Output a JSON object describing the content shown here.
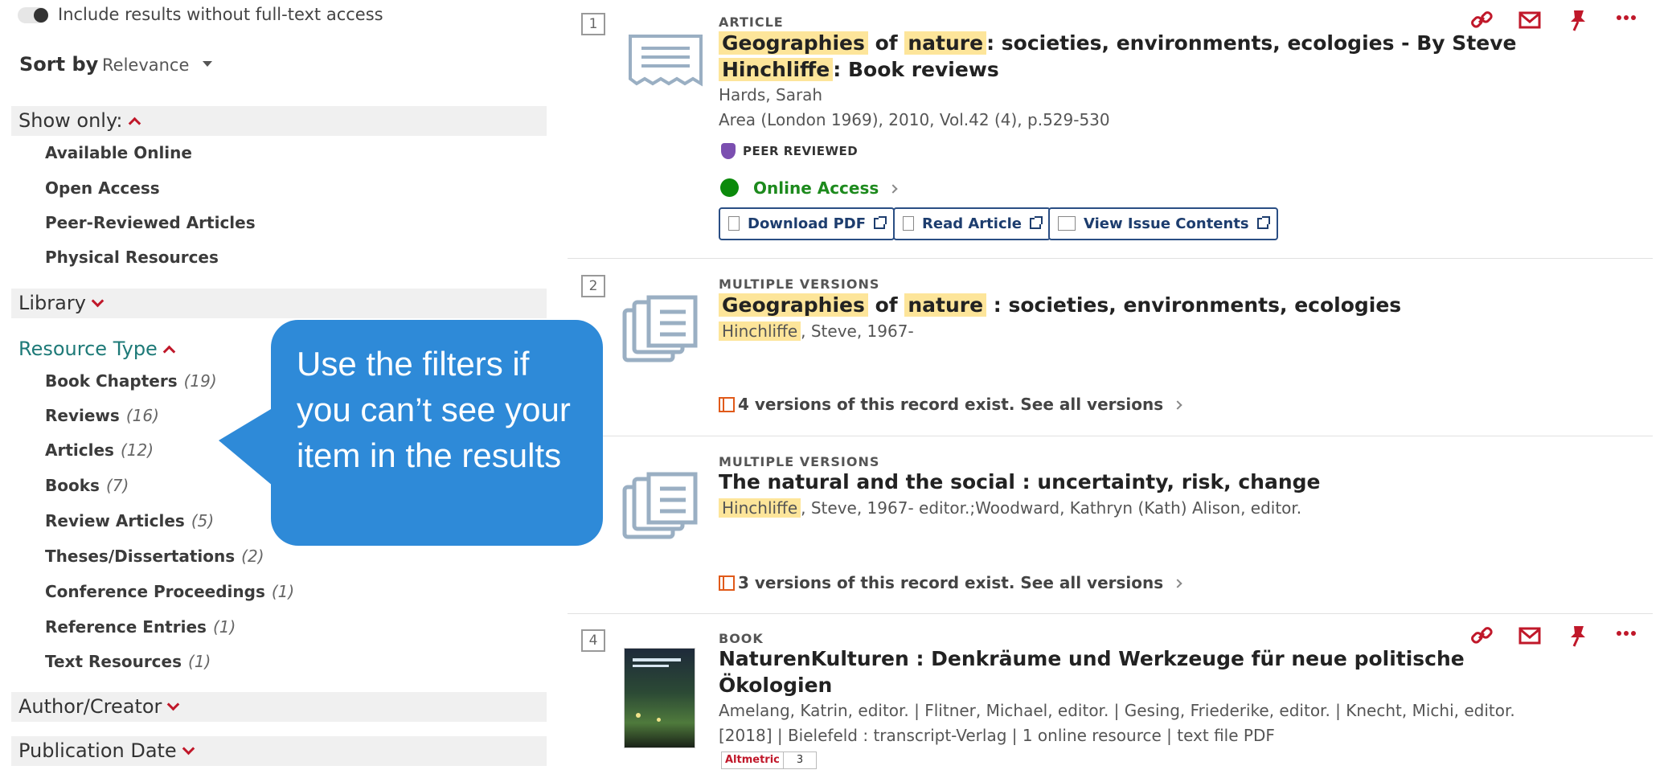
{
  "facets": {
    "toggle_label": "Include results without full-text access",
    "sort": {
      "label": "Sort by",
      "value": "Relevance"
    },
    "show_only": {
      "heading": "Show only:",
      "items": [
        "Available Online",
        "Open Access",
        "Peer-Reviewed Articles",
        "Physical Resources"
      ]
    },
    "library": {
      "heading": "Library"
    },
    "resource_type": {
      "heading": "Resource Type",
      "items": [
        {
          "label": "Book Chapters",
          "count": "(19)"
        },
        {
          "label": "Reviews",
          "count": "(16)"
        },
        {
          "label": "Articles",
          "count": "(12)"
        },
        {
          "label": "Books",
          "count": "(7)"
        },
        {
          "label": "Review Articles",
          "count": "(5)"
        },
        {
          "label": "Theses/Dissertations",
          "count": "(2)"
        },
        {
          "label": "Conference Proceedings",
          "count": "(1)"
        },
        {
          "label": "Reference Entries",
          "count": "(1)"
        },
        {
          "label": "Text Resources",
          "count": "(1)"
        }
      ]
    },
    "author": {
      "heading": "Author/Creator"
    },
    "pubdate": {
      "heading": "Publication Date"
    }
  },
  "callout": {
    "text": "Use the filters if you can’t see your item in the results"
  },
  "results": [
    {
      "number": "1",
      "type": "ARTICLE",
      "title_parts": [
        "Geographies",
        "of",
        "nature",
        ": societies, environments, ecologies - By Steve",
        "Hinchliffe",
        ": Book reviews"
      ],
      "author": "Hards, Sarah",
      "source": "Area (London 1969), 2010, Vol.42 (4), p.529-530",
      "peer_reviewed": "PEER REVIEWED",
      "access": "Online Access",
      "buttons": [
        "Download PDF",
        "Read Article",
        "View Issue Contents"
      ]
    },
    {
      "number": "2",
      "type": "MULTIPLE VERSIONS",
      "title_parts": [
        "Geographies",
        "of",
        "nature",
        ": societies, environments, ecologies"
      ],
      "author_hl": "Hinchliffe",
      "author_rest": ", Steve, 1967-",
      "versions": "4 versions of this record exist. See all versions"
    },
    {
      "number": "3",
      "type": "MULTIPLE VERSIONS",
      "title": "The natural and the social : uncertainty, risk, change",
      "author_hl": "Hinchliffe",
      "author_rest": ", Steve, 1967- editor.;Woodward, Kathryn (Kath) Alison, editor.",
      "versions": "3 versions of this record exist. See all versions"
    },
    {
      "number": "4",
      "type": "BOOK",
      "title_line1": "NaturenKulturen : Denkräume und Werkzeuge für neue politische",
      "title_line2": "Ökologien",
      "authors": "Amelang, Katrin, editor. | Flitner, Michael, editor. | Gesing, Friederike, editor. | Knecht, Michi, editor.",
      "pubinfo": "[2018] | Bielefeld : transcript-Verlag | 1 online resource | text file PDF",
      "altmetric_label": "Altmetric",
      "altmetric_score": "3"
    }
  ],
  "icons": {
    "link": "link-icon",
    "email": "email-icon",
    "pin": "pin-icon",
    "more": "more-icon",
    "accent_color": "#c0182a",
    "online_color": "#0b8a0b",
    "highlight_color": "#fde59a",
    "callout_color": "#2e8ad8"
  }
}
